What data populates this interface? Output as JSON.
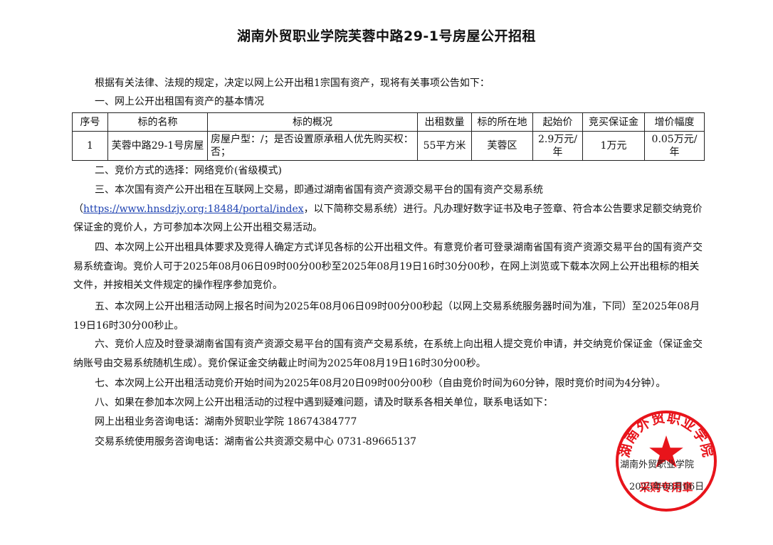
{
  "title": "湖南外贸职业学院芙蓉中路29-1号房屋公开招租",
  "intro": "根据有关法律、法规的规定，决定以网上公开出租1宗国有资产，现将有关事项公告如下：",
  "section1": "一、网上公开出租国有资产的基本情况",
  "table": {
    "headers": [
      "序号",
      "标的名称",
      "标的概况",
      "出租数量",
      "标的所在地",
      "起始价",
      "竞买保证金",
      "增价幅度"
    ],
    "row": {
      "no": "1",
      "name": "芙蓉中路29-1号房屋",
      "overview": "房屋户型：/；是否设置原承租人优先购买权：否；",
      "quantity": "55平方米",
      "location": "芙蓉区",
      "start_price": "2.9万元/年",
      "deposit": "1万元",
      "increment": "0.05万元/年"
    }
  },
  "section2": "二、竞价方式的选择：网络竞价(省级模式)",
  "section3": {
    "line1": "三、本次国有资产公开出租在互联网上交易，即通过湖南省国有资产资源交易平台的国有资产交易系统",
    "paren_open": "（",
    "link": "https://www.hnsdzjy.org:18484/portal/index",
    "rest": "，以下简称交易系统）进行。凡办理好数字证书及电子签章、符合本公告要求足额交纳竞价保证金的竞价人，方可参加本次网上公开出租交易活动。"
  },
  "section4": "四、本次网上公开出租具体要求及竞得人确定方式详见各标的公开出租文件。有意竞价者可登录湖南省国有资产资源交易平台的国有资产交易系统查询。竞价人可于2025年08月06日09时00分00秒至2025年08月19日16时30分00秒，在网上浏览或下载本次网上公开出租标的相关文件，并按相关文件规定的操作程序参加竞价。",
  "section5": "五、本次网上公开出租活动网上报名时间为2025年08月06日09时00分00秒起（以网上交易系统服务器时间为准，下同）至2025年08月19日16时30分00秒止。",
  "section6": "六、竞价人应及时登录湖南省国有资产资源交易平台的国有资产交易系统，在系统上向出租人提交竞价申请，并交纳竞价保证金（保证金交纳账号由交易系统随机生成）。竞价保证金交纳截止时间为2025年08月19日16时30分00秒。",
  "section7": "七、本次网上公开出租活动竞价开始时间为2025年08月20日09时00分00秒（自由竞价时间为60分钟，限时竞价时间为4分钟）。",
  "section8": "八、如果在参加本次网上公开出租活动的过程中遇到疑难问题，请及时联系各相关单位，联系电话如下：",
  "contact1": "网上出租业务咨询电话：湖南外贸职业学院 18674384777",
  "contact2": "交易系统使用服务咨询电话：湖南省公共资源交易中心 0731-89665137",
  "signature": {
    "org": "湖南外贸职业学院",
    "date": "2025年08月06日"
  },
  "stamp": {
    "arc_text": "湖南外贸职业学院",
    "bottom_text": "采购专用章",
    "color": "#e8141b"
  }
}
